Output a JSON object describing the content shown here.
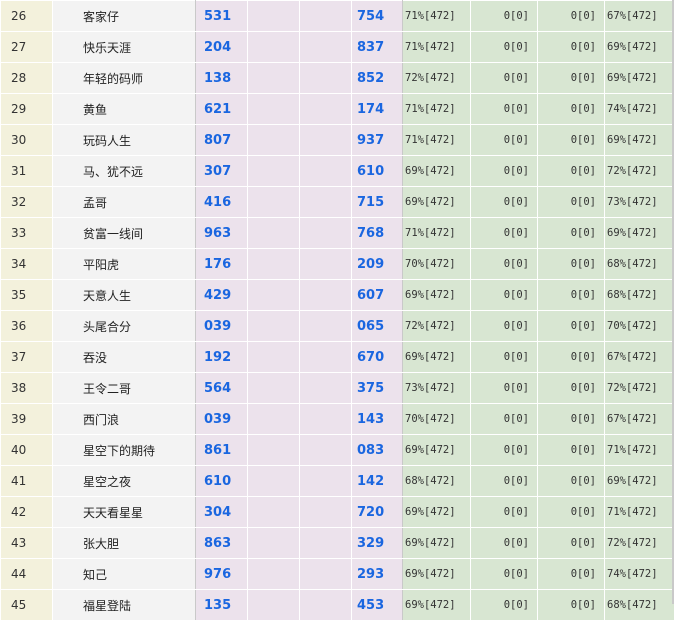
{
  "rows": [
    {
      "num": "26",
      "name": "客家仔",
      "v1": "531",
      "v2": "754",
      "p1": "71%[472]",
      "p2": "0[0]",
      "p3": "0[0]",
      "p4": "67%[472]"
    },
    {
      "num": "27",
      "name": "快乐天涯",
      "v1": "204",
      "v2": "837",
      "p1": "71%[472]",
      "p2": "0[0]",
      "p3": "0[0]",
      "p4": "69%[472]"
    },
    {
      "num": "28",
      "name": "年轻的码师",
      "v1": "138",
      "v2": "852",
      "p1": "72%[472]",
      "p2": "0[0]",
      "p3": "0[0]",
      "p4": "69%[472]"
    },
    {
      "num": "29",
      "name": "黄鱼",
      "v1": "621",
      "v2": "174",
      "p1": "71%[472]",
      "p2": "0[0]",
      "p3": "0[0]",
      "p4": "74%[472]"
    },
    {
      "num": "30",
      "name": "玩码人生",
      "v1": "807",
      "v2": "937",
      "p1": "71%[472]",
      "p2": "0[0]",
      "p3": "0[0]",
      "p4": "69%[472]"
    },
    {
      "num": "31",
      "name": "马、犹不远",
      "v1": "307",
      "v2": "610",
      "p1": "69%[472]",
      "p2": "0[0]",
      "p3": "0[0]",
      "p4": "72%[472]"
    },
    {
      "num": "32",
      "name": "孟哥",
      "v1": "416",
      "v2": "715",
      "p1": "69%[472]",
      "p2": "0[0]",
      "p3": "0[0]",
      "p4": "73%[472]"
    },
    {
      "num": "33",
      "name": "贫富一线间",
      "v1": "963",
      "v2": "768",
      "p1": "71%[472]",
      "p2": "0[0]",
      "p3": "0[0]",
      "p4": "69%[472]"
    },
    {
      "num": "34",
      "name": "平阳虎",
      "v1": "176",
      "v2": "209",
      "p1": "70%[472]",
      "p2": "0[0]",
      "p3": "0[0]",
      "p4": "68%[472]"
    },
    {
      "num": "35",
      "name": "天意人生",
      "v1": "429",
      "v2": "607",
      "p1": "69%[472]",
      "p2": "0[0]",
      "p3": "0[0]",
      "p4": "68%[472]"
    },
    {
      "num": "36",
      "name": "头尾合分",
      "v1": "039",
      "v2": "065",
      "p1": "72%[472]",
      "p2": "0[0]",
      "p3": "0[0]",
      "p4": "70%[472]"
    },
    {
      "num": "37",
      "name": "吞没",
      "v1": "192",
      "v2": "670",
      "p1": "69%[472]",
      "p2": "0[0]",
      "p3": "0[0]",
      "p4": "67%[472]"
    },
    {
      "num": "38",
      "name": "王令二哥",
      "v1": "564",
      "v2": "375",
      "p1": "73%[472]",
      "p2": "0[0]",
      "p3": "0[0]",
      "p4": "72%[472]"
    },
    {
      "num": "39",
      "name": "西门浪",
      "v1": "039",
      "v2": "143",
      "p1": "70%[472]",
      "p2": "0[0]",
      "p3": "0[0]",
      "p4": "67%[472]"
    },
    {
      "num": "40",
      "name": "星空下的期待",
      "v1": "861",
      "v2": "083",
      "p1": "69%[472]",
      "p2": "0[0]",
      "p3": "0[0]",
      "p4": "71%[472]"
    },
    {
      "num": "41",
      "name": "星空之夜",
      "v1": "610",
      "v2": "142",
      "p1": "68%[472]",
      "p2": "0[0]",
      "p3": "0[0]",
      "p4": "69%[472]"
    },
    {
      "num": "42",
      "name": "天天看星星",
      "v1": "304",
      "v2": "720",
      "p1": "69%[472]",
      "p2": "0[0]",
      "p3": "0[0]",
      "p4": "71%[472]"
    },
    {
      "num": "43",
      "name": "张大胆",
      "v1": "863",
      "v2": "329",
      "p1": "69%[472]",
      "p2": "0[0]",
      "p3": "0[0]",
      "p4": "72%[472]"
    },
    {
      "num": "44",
      "name": "知己",
      "v1": "976",
      "v2": "293",
      "p1": "69%[472]",
      "p2": "0[0]",
      "p3": "0[0]",
      "p4": "74%[472]"
    },
    {
      "num": "45",
      "name": "福星登陆",
      "v1": "135",
      "v2": "453",
      "p1": "69%[472]",
      "p2": "0[0]",
      "p3": "0[0]",
      "p4": "68%[472]"
    }
  ]
}
